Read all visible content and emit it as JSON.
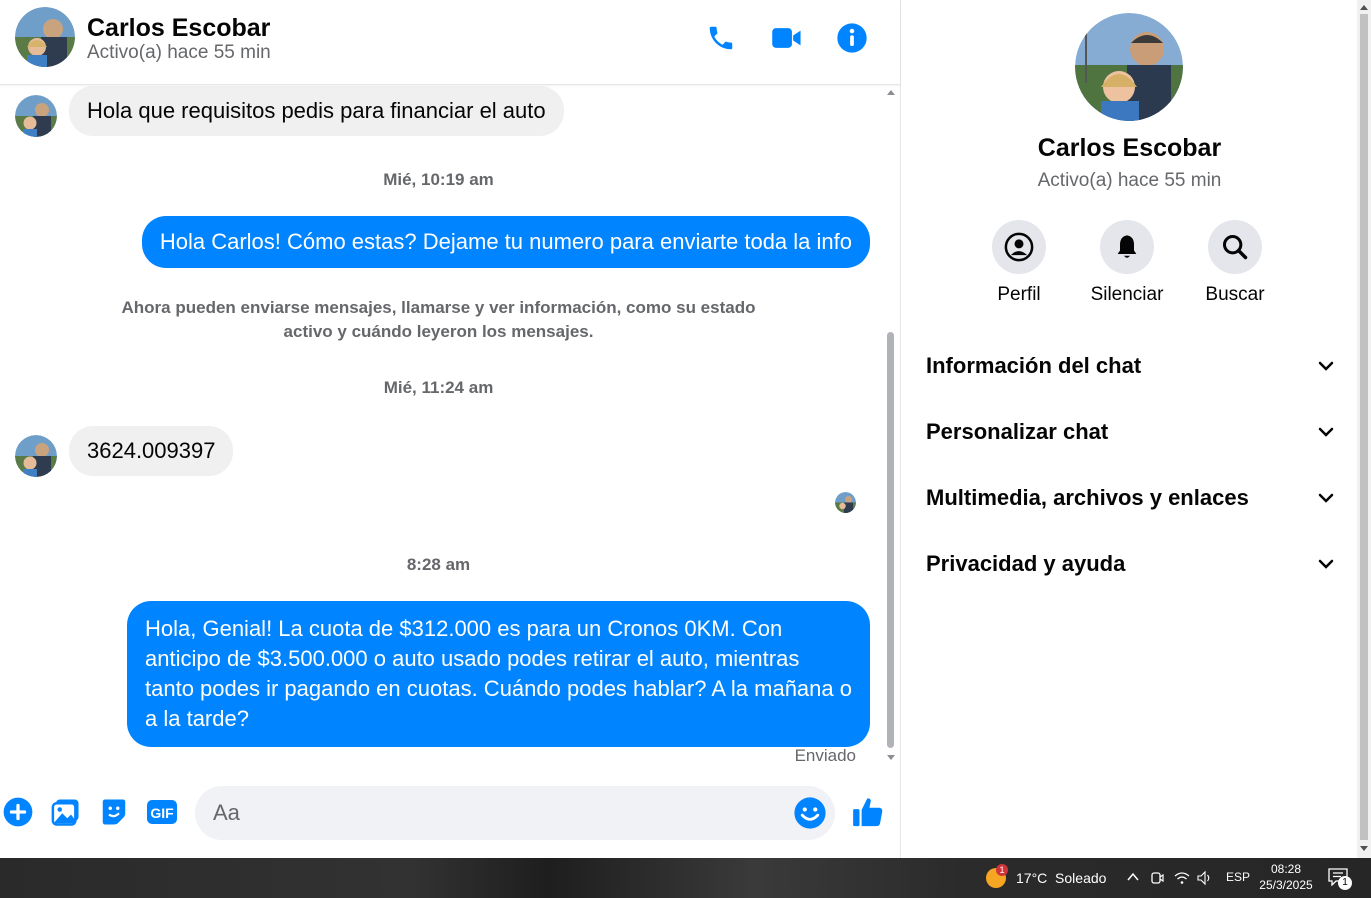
{
  "contact": {
    "name": "Carlos Escobar",
    "status": "Activo(a) hace 55 min"
  },
  "header": {
    "call_icon": "phone-icon",
    "video_icon": "video-camera-icon",
    "info_icon": "info-icon"
  },
  "messages": [
    {
      "type": "incoming",
      "text": "Hola que requisitos pedis para financiar el auto"
    },
    {
      "type": "timestamp",
      "text": "Mié, 10:19 am"
    },
    {
      "type": "outgoing",
      "text": "Hola Carlos! Cómo estas? Dejame tu numero para enviarte toda la info"
    },
    {
      "type": "system",
      "text": "Ahora pueden enviarse mensajes, llamarse y ver información, como su estado activo y cuándo leyeron los mensajes."
    },
    {
      "type": "timestamp",
      "text": "Mié, 11:24 am"
    },
    {
      "type": "incoming",
      "text": "3624.009397"
    },
    {
      "type": "timestamp",
      "text": "8:28 am"
    },
    {
      "type": "outgoing",
      "text": "Hola, Genial! La cuota de $312.000 es para un Cronos 0KM. Con anticipo de $3.500.000 o auto usado podes retirar el auto, mientras tanto podes ir pagando en cuotas. Cuándo podes hablar? A la mañana o a la tarde?"
    },
    {
      "type": "receipt",
      "text": "Enviado"
    }
  ],
  "composer": {
    "placeholder": "Aa",
    "gif_label": "GIF"
  },
  "panel": {
    "actions": [
      {
        "label": "Perfil",
        "icon": "profile-icon"
      },
      {
        "label": "Silenciar",
        "icon": "bell-icon"
      },
      {
        "label": "Buscar",
        "icon": "search-icon"
      }
    ],
    "sections": [
      "Información del chat",
      "Personalizar chat",
      "Multimedia, archivos y enlaces",
      "Privacidad y ayuda"
    ]
  },
  "taskbar": {
    "weather_badge": "1",
    "weather": "17°C  Soleado",
    "language": "ESP",
    "time": "08:28",
    "date": "25/3/2025",
    "notification_count": "1"
  },
  "colors": {
    "accent": "#0084ff",
    "incoming_bubble": "#f0f0f0",
    "secondary_text": "#65676b"
  }
}
